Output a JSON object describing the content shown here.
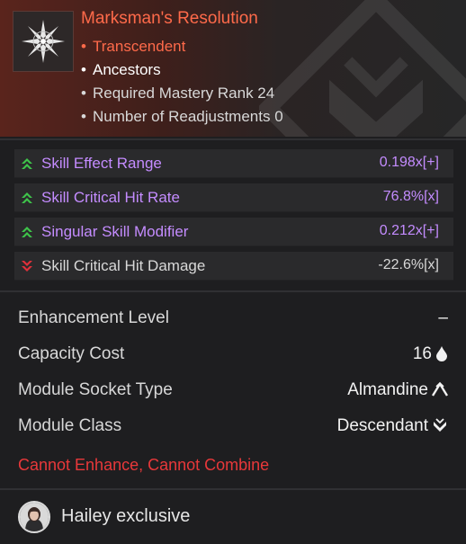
{
  "item": {
    "title": "Marksman's Resolution",
    "icon": "snowflake-star-icon",
    "rarity": "Transcendent",
    "socket_category": "Ancestors",
    "mastery_requirement": "Required Mastery Rank 24",
    "readjustments": "Number of Readjustments 0"
  },
  "stats": [
    {
      "label": "Skill Effect Range",
      "value": "0.198x[+]",
      "direction": "up",
      "icon": "up-arrow-icon"
    },
    {
      "label": "Skill Critical Hit Rate",
      "value": "76.8%[x]",
      "direction": "up",
      "icon": "up-arrow-icon"
    },
    {
      "label": "Singular Skill Modifier",
      "value": "0.212x[+]",
      "direction": "up",
      "icon": "up-arrow-icon"
    },
    {
      "label": "Skill Critical Hit Damage",
      "value": "-22.6%[x]",
      "direction": "down",
      "icon": "down-arrow-icon"
    }
  ],
  "info": {
    "enhancement": {
      "label": "Enhancement Level",
      "value": "–"
    },
    "capacity": {
      "label": "Capacity Cost",
      "value": "16",
      "icon": "drop-icon"
    },
    "socket_type": {
      "label": "Module Socket Type",
      "value": "Almandine",
      "icon": "almandine-socket-icon"
    },
    "module_class": {
      "label": "Module Class",
      "value": "Descendant",
      "icon": "descendant-class-icon"
    }
  },
  "warning": "Cannot Enhance, Cannot Combine",
  "footer": {
    "exclusive": "Hailey exclusive",
    "avatar": "hailey-avatar"
  },
  "colors": {
    "rarity": "#ff6a4a",
    "stat_up": "#c48cff",
    "arrow_up": "#3ec44a",
    "arrow_down": "#e0303a",
    "warning": "#e8383a"
  }
}
